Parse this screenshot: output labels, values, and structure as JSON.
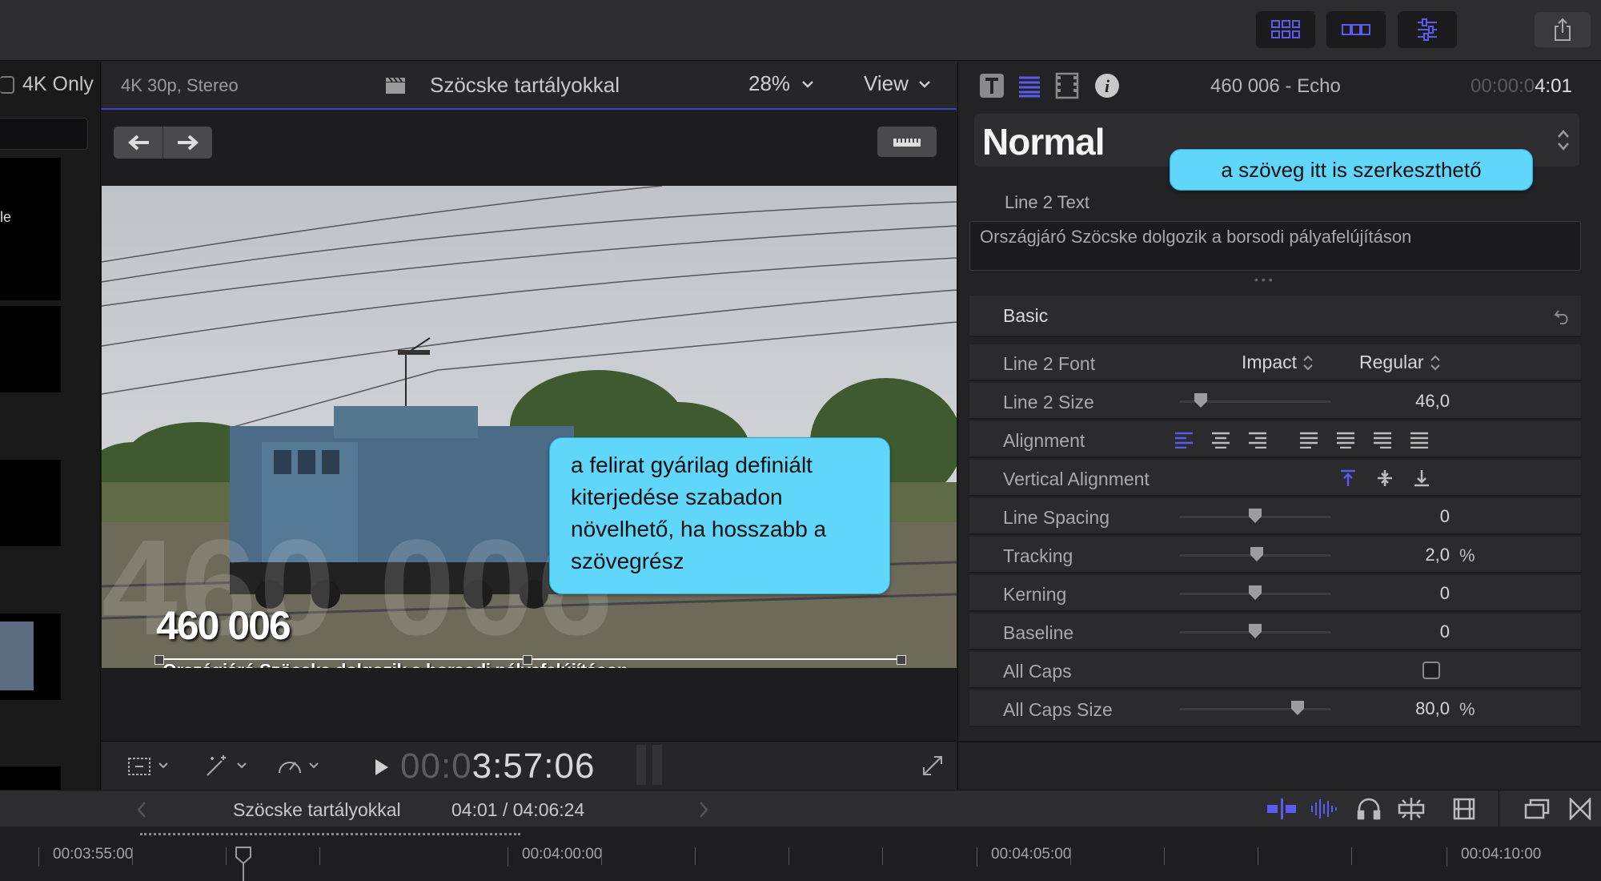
{
  "browser": {
    "filter_label": "4K Only",
    "thumb_text": "le"
  },
  "viewer": {
    "format": "4K 30p, Stereo",
    "clip_title": "Szöcske tartályokkal",
    "zoom": "28%",
    "view_label": "View",
    "title_line1": "460 006",
    "title_line2": "Országjáró Szöcske dolgozik a borsodi pályafelújításon",
    "timecode_dim": "00:0",
    "timecode_bright": "3:57:06"
  },
  "inspector": {
    "clip_name": "460 006 - Echo",
    "timecode_dim": "00:00:0",
    "timecode_bright": "4:01",
    "preset": "Normal",
    "text_label": "Line 2 Text",
    "text_value": "Országjáró Szöcske dolgozik a borsodi pályafelújításon",
    "section": "Basic",
    "rows": {
      "font": {
        "label": "Line 2 Font",
        "family": "Impact",
        "style": "Regular"
      },
      "size": {
        "label": "Line 2 Size",
        "value": "46,0"
      },
      "alignment": {
        "label": "Alignment"
      },
      "valign": {
        "label": "Vertical Alignment"
      },
      "line_spacing": {
        "label": "Line Spacing",
        "value": "0"
      },
      "tracking": {
        "label": "Tracking",
        "value": "2,0",
        "unit": "%"
      },
      "kerning": {
        "label": "Kerning",
        "value": "0"
      },
      "baseline": {
        "label": "Baseline",
        "value": "0"
      },
      "all_caps": {
        "label": "All Caps",
        "checked": false
      },
      "all_caps_size": {
        "label": "All Caps Size",
        "value": "80,0",
        "unit": "%"
      }
    }
  },
  "timeline": {
    "project_name": "Szöcske tartályokkal",
    "position": "04:01 / 04:06:24",
    "ruler": [
      "00:03:55:00",
      "00:04:00:00",
      "00:04:05:00",
      "00:04:10:00"
    ]
  },
  "callouts": {
    "inspector_note": "a szöveg itt is szerkeszthető",
    "viewer_note": "a felirat gyárilag definiált kiterjedése szabadon növelhető, ha hosszabb a szövegrész"
  },
  "colors": {
    "accent": "#5a5cf0",
    "callout": "#5fd6fa",
    "panel": "#232325"
  },
  "icons": [
    "grid-icon",
    "filmstrip-icon",
    "sliders-icon",
    "share-icon",
    "text-inspector-icon",
    "paragraph-icon",
    "video-inspector-icon",
    "info-icon",
    "clapper-icon",
    "undo-arrow-icon",
    "back-arrow-icon",
    "forward-arrow-icon",
    "ruler-icon",
    "crop-icon",
    "magic-wand-icon",
    "speedometer-icon",
    "play-icon",
    "fullscreen-icon",
    "snapping-icon",
    "waveform-icon",
    "headphones-icon",
    "skimming-icon",
    "clip-appearance-icon",
    "window-icon",
    "bowtie-icon"
  ]
}
